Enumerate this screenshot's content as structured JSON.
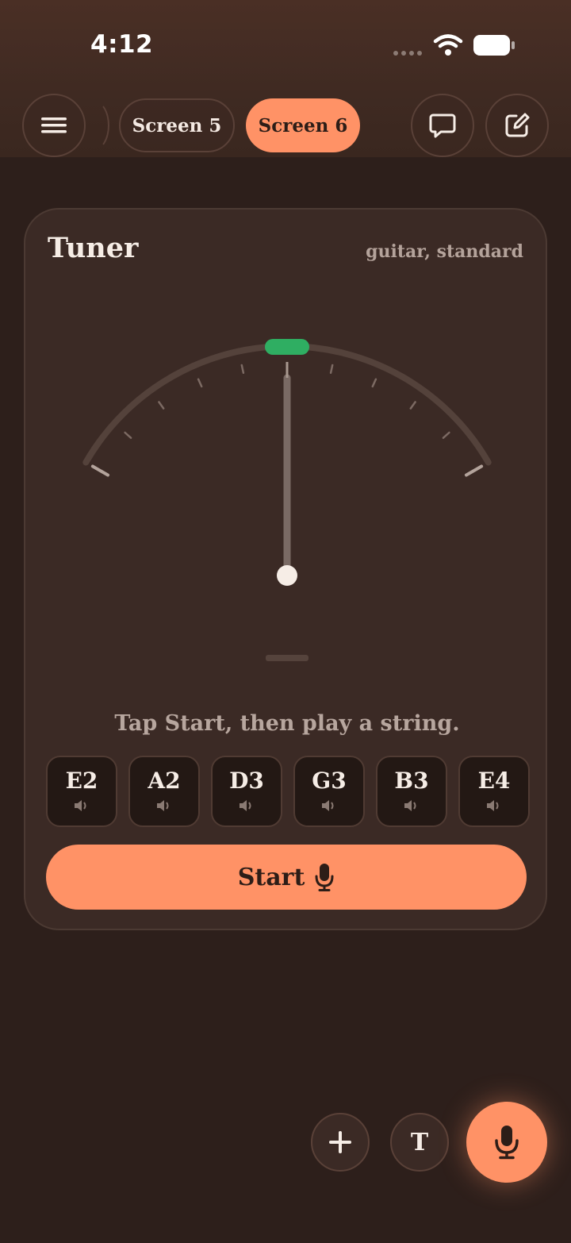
{
  "status_bar": {
    "time": "4:12"
  },
  "nav": {
    "tabs": [
      {
        "label": "Screen 5",
        "active": false
      },
      {
        "label": "Screen 6",
        "active": true
      }
    ]
  },
  "tuner": {
    "title": "Tuner",
    "instrument": "guitar, standard",
    "hint": "Tap Start, then play a string.",
    "needle_position": 0,
    "strings": [
      "E2",
      "A2",
      "D3",
      "G3",
      "B3",
      "E4"
    ],
    "start_label": "Start"
  },
  "fab": {
    "text_label": "T"
  },
  "colors": {
    "accent": "#ff9266",
    "in_tune": "#2fae62",
    "background": "#2d1f1b",
    "card": "#3b2a25"
  }
}
